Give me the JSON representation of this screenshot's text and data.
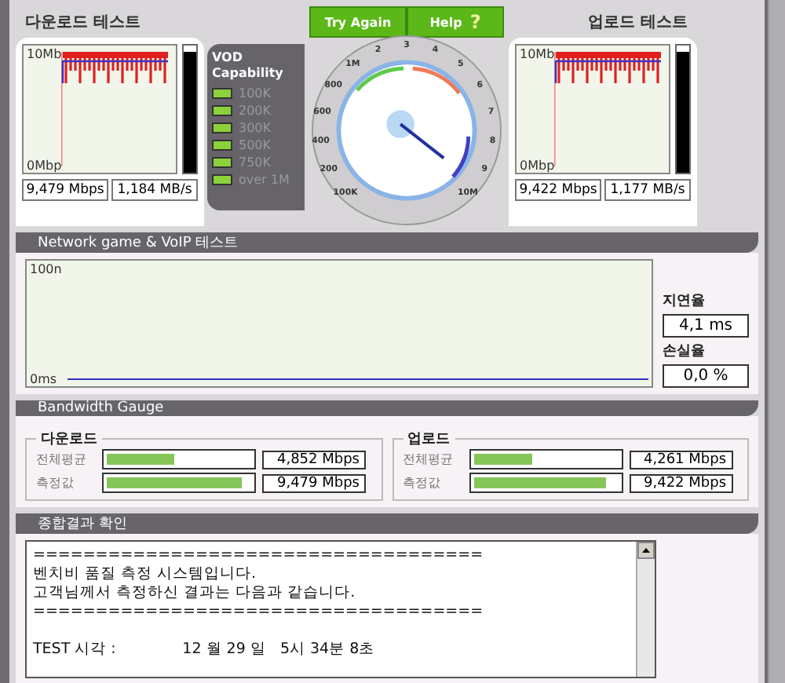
{
  "download_test": {
    "title": "다운로드 테스트",
    "axis_top": "10Mb",
    "axis_bottom": "0Mbp",
    "meter": {
      "level": 0.95
    },
    "speed": "9,479 Mbps",
    "rate": "1,184 MB/s"
  },
  "vod": {
    "title": "VOD Capability",
    "items": [
      {
        "label": "100K",
        "lit": true
      },
      {
        "label": "200K",
        "lit": true
      },
      {
        "label": "300K",
        "lit": true
      },
      {
        "label": "500K",
        "lit": true
      },
      {
        "label": "750K",
        "lit": true
      },
      {
        "label": "over 1M",
        "lit": true
      }
    ]
  },
  "gauge": {
    "buttons": [
      "Try Again",
      "Help"
    ],
    "help_mark": "?",
    "scale": [
      "100K",
      "200",
      "400",
      "600",
      "800",
      "1M",
      "2",
      "3",
      "4",
      "5",
      "6",
      "7",
      "8",
      "9",
      "10M"
    ]
  },
  "upload_test": {
    "title": "업로드 테스트",
    "axis_top": "10Mb",
    "axis_bottom": "0Mbp",
    "meter": {
      "level": 0.95
    },
    "speed": "9,422 Mbps",
    "rate": "1,177 MB/s"
  },
  "network": {
    "title": "Network game & VoIP 테스트",
    "axis_top": "100n",
    "axis_bottom": "0ms",
    "latency_label": "지연율",
    "latency": "4,1 ms",
    "loss_label": "손실율",
    "loss": "0,0 %"
  },
  "bandwidth": {
    "title": "Bandwidth Gauge",
    "groups": [
      {
        "title": "다운로드",
        "rows": [
          {
            "label": "전체평균",
            "level": 0.47,
            "value": "4,852 Mbps"
          },
          {
            "label": "측정값",
            "level": 0.93,
            "value": "9,479 Mbps"
          }
        ]
      },
      {
        "title": "업로드",
        "rows": [
          {
            "label": "전체평균",
            "level": 0.41,
            "value": "4,261 Mbps"
          },
          {
            "label": "측정값",
            "level": 0.92,
            "value": "9,422 Mbps"
          }
        ]
      }
    ]
  },
  "summary": {
    "title": "종합결과 확인",
    "lines": [
      "====================================",
      "벤치비 품질 측정 시스템입니다.",
      "고객님께서 측정하신 결과는 다음과 같습니다.",
      "===================================="
    ],
    "time_line": "TEST 시각 :              12 월 29 일   5시 34분 8초"
  }
}
